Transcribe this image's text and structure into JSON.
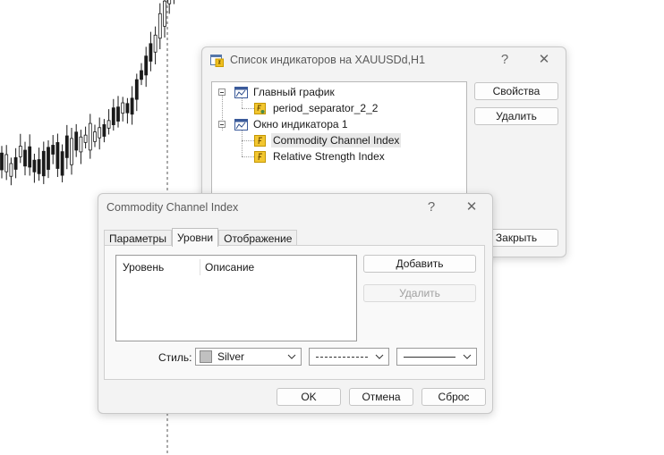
{
  "indicator_list_dialog": {
    "title": "Список индикаторов на XAUUSDd,H1",
    "help": "?",
    "close": "✕",
    "tree": [
      {
        "label": "Главный график",
        "type": "chart"
      },
      {
        "label": "period_separator_2_2",
        "type": "script"
      },
      {
        "label": "Окно индикатора 1",
        "type": "chart"
      },
      {
        "label": "Commodity Channel Index",
        "type": "indicator",
        "selected": true
      },
      {
        "label": "Relative Strength Index",
        "type": "indicator"
      }
    ],
    "buttons": {
      "properties": "Свойства",
      "delete": "Удалить",
      "close": "Закрыть"
    }
  },
  "cci_dialog": {
    "title": "Commodity Channel Index",
    "help": "?",
    "close": "✕",
    "tabs": [
      "Параметры",
      "Уровни",
      "Отображение"
    ],
    "active_tab": "Уровни",
    "levels_table": {
      "columns": [
        "Уровень",
        "Описание"
      ],
      "rows": []
    },
    "buttons": {
      "add": "Добавить",
      "delete": "Удалить"
    },
    "style_label": "Стиль:",
    "color_value": "Silver",
    "color_swatch": "#c0c0c0",
    "footer": {
      "ok": "OK",
      "cancel": "Отмена",
      "reset": "Сброс"
    }
  }
}
